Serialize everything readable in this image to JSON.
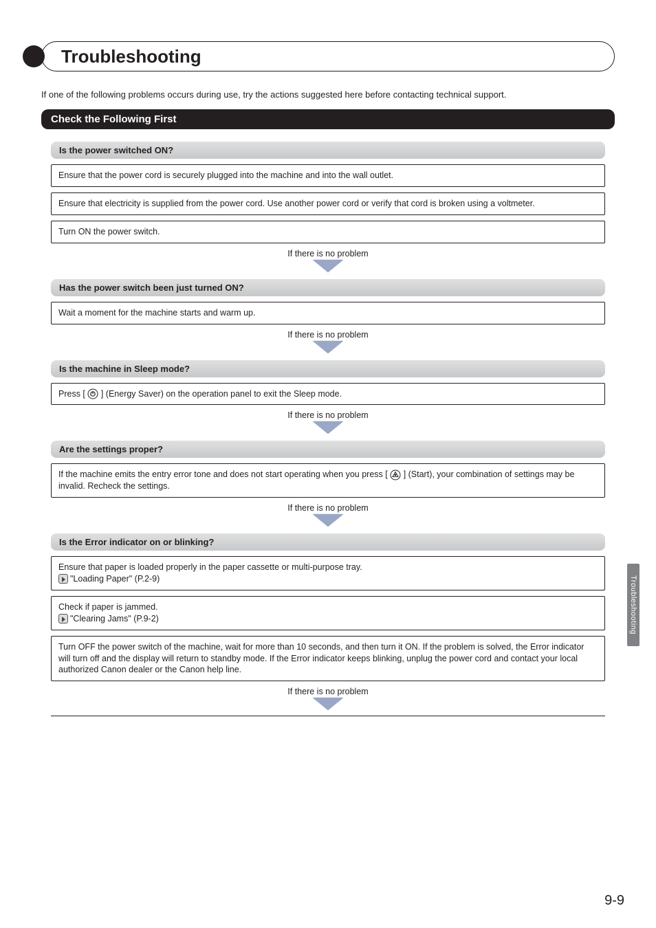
{
  "side_tab": "Troubleshooting",
  "title": "Troubleshooting",
  "intro": "If one of the following problems occurs during use, try the actions suggested here before contacting technical support.",
  "section_heading": "Check the Following First",
  "flow_label": "If there is no problem",
  "groups": [
    {
      "heading": "Is the power switched ON?",
      "boxes": [
        {
          "text": "Ensure that the power cord is securely plugged into the machine and into the wall outlet."
        },
        {
          "text": "Ensure that electricity is supplied from the power cord. Use another power cord or verify that cord is broken using a voltmeter."
        },
        {
          "text": "Turn ON the power switch."
        }
      ],
      "arrow_after": true
    },
    {
      "heading": "Has the power switch been just turned ON?",
      "boxes": [
        {
          "text": "Wait a moment for the machine starts and warm up."
        }
      ],
      "arrow_after": true
    },
    {
      "heading": "Is the machine in Sleep mode?",
      "boxes": [
        {
          "pre": "Press [ ",
          "icon": "energy-saver",
          "post": " ] (Energy Saver) on the operation panel to exit the Sleep mode."
        }
      ],
      "arrow_after": true
    },
    {
      "heading": "Are the settings proper?",
      "boxes": [
        {
          "pre": "If the machine emits the entry error tone and does not start operating when you press [ ",
          "icon": "start",
          "post": " ] (Start), your combination of settings may be invalid. Recheck the settings."
        }
      ],
      "arrow_after": true
    },
    {
      "heading": "Is the Error indicator on or blinking?",
      "boxes": [
        {
          "text": "Ensure that paper is loaded properly in the paper cassette or multi-purpose tray.",
          "ref": "\"Loading Paper\" (P.2-9)"
        },
        {
          "text": "Check if paper is jammed.",
          "ref": "\"Clearing Jams\" (P.9-2)"
        },
        {
          "text": "Turn OFF the power switch of the machine, wait for more than 10 seconds, and then turn it ON. If the problem is solved, the Error indicator will turn off and the display will return to standby mode. If the Error indicator keeps blinking, unplug the power cord and contact your local authorized Canon dealer or the Canon help line."
        }
      ],
      "arrow_after": true,
      "final_divider": true
    }
  ],
  "page_number": "9-9"
}
